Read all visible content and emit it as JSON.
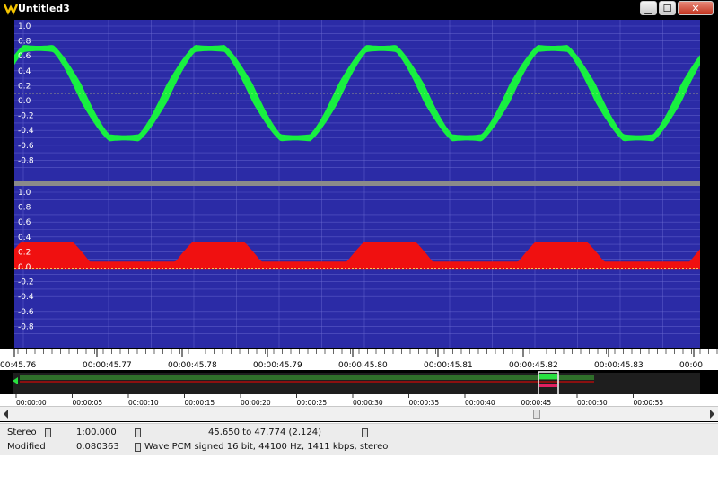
{
  "window": {
    "title": "Untitled3",
    "minimize": "▁",
    "maximize": "☐",
    "close": "✕"
  },
  "colors": {
    "background": "#2b2ba6",
    "grid": "#6b6bd0",
    "channel1": "#18f040",
    "channel2": "#f01010",
    "centerline": "#ffff66"
  },
  "channels": [
    {
      "y_labels": [
        "1.0",
        "0.8",
        "0.6",
        "0.4",
        "0.2",
        "0.0",
        "-0.2",
        "-0.4",
        "-0.6",
        "-0.8"
      ]
    },
    {
      "y_labels": [
        "1.0",
        "0.8",
        "0.6",
        "0.4",
        "0.2",
        "0.0",
        "-0.2",
        "-0.4",
        "-0.6",
        "-0.8"
      ]
    }
  ],
  "timeline": {
    "labels": [
      "00:45.76",
      "00:00:45.77",
      "00:00:45.78",
      "00:00:45.79",
      "00:00:45.80",
      "00:00:45.81",
      "00:00:45.82",
      "00:00:45.83",
      "00:00"
    ]
  },
  "overview": {
    "labels": [
      "00:00:00",
      "00:00:05",
      "00:00:10",
      "00:00:15",
      "00:00:20",
      "00:00:25",
      "00:00:30",
      "00:00:35",
      "00:00:40",
      "00:00:45",
      "00:00:50",
      "00:00:55"
    ]
  },
  "status": {
    "row1": {
      "mode": "Stereo",
      "duration": "1:00.000",
      "selection": "45.650 to 47.774 (2.124)"
    },
    "row2": {
      "state": "Modified",
      "value": "0.080363",
      "format": "Wave PCM signed 16 bit, 44100 Hz, 1411 kbps, stereo"
    }
  }
}
